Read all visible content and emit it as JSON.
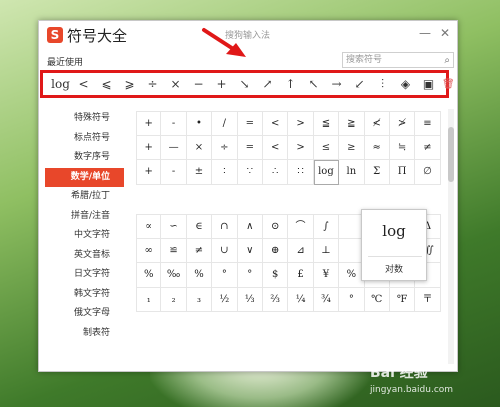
{
  "window": {
    "title": "符号大全",
    "ime_name": "搜狗输入法",
    "logo": "S",
    "minimize": "—",
    "close": "✕"
  },
  "recent": {
    "label": "最近使用",
    "items": [
      "log",
      "<",
      "⩽",
      "⩾",
      "÷",
      "×",
      "−",
      "+",
      "↘",
      "↗",
      "↑",
      "↖",
      "→",
      "↙",
      "⫶",
      "◈",
      "▣"
    ]
  },
  "search": {
    "placeholder": "搜索符号"
  },
  "sidebar": {
    "items": [
      {
        "label": "特殊符号"
      },
      {
        "label": "标点符号"
      },
      {
        "label": "数字序号"
      },
      {
        "label": "数学/单位",
        "active": true
      },
      {
        "label": "希腊/拉丁"
      },
      {
        "label": "拼音/注音"
      },
      {
        "label": "中文字符"
      },
      {
        "label": "英文音标"
      },
      {
        "label": "日文字符"
      },
      {
        "label": "韩文字符"
      },
      {
        "label": "俄文字母"
      },
      {
        "label": "制表符"
      }
    ]
  },
  "grid_a": [
    "+",
    "-",
    "•",
    "/",
    "=",
    "<",
    ">",
    "≦",
    "≧",
    "≮",
    "≯",
    "≡",
    "+",
    "—",
    "×",
    "÷",
    "=",
    "<",
    ">",
    "≤",
    "≥",
    "≈",
    "≒",
    "≠",
    "+",
    "-",
    "±",
    "∶",
    "∵",
    "∴",
    "∷",
    "log",
    "ln",
    "Σ",
    "Π",
    "∅"
  ],
  "grid_b": [
    "∝",
    "∽",
    "∈",
    "∩",
    "∧",
    "⊙",
    "⌒",
    "∫",
    "",
    "",
    "∂",
    "Δ",
    "∞",
    "≌",
    "≠",
    "∪",
    "∨",
    "⊕",
    "⊿",
    "⊥",
    "",
    "",
    "∬",
    "∭",
    "%",
    "‰",
    "%",
    "°",
    "°",
    "$",
    "£",
    "¥",
    "%",
    "",
    "",
    "",
    "₁",
    "₂",
    "₃",
    "½",
    "⅓",
    "⅔",
    "¼",
    "¾",
    "°",
    "℃",
    "℉",
    "〒"
  ],
  "popup": {
    "symbol": "log",
    "name": "对数"
  },
  "watermark": {
    "brand": "Bai 经验",
    "url": "jingyan.baidu.com"
  },
  "icons": {
    "trash": "trash-icon",
    "search": "search-icon",
    "arrow_color": "#e01818",
    "accent": "#e8472a"
  }
}
